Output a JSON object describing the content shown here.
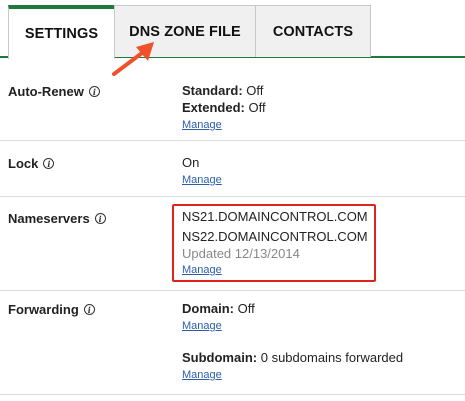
{
  "tabs": {
    "settings": "SETTINGS",
    "dns_zone_file": "DNS ZONE FILE",
    "contacts": "CONTACTS",
    "active": "SETTINGS"
  },
  "auto_renew": {
    "label": "Auto-Renew",
    "standard_label": "Standard:",
    "standard_value": "Off",
    "extended_label": "Extended:",
    "extended_value": "Off",
    "manage": "Manage"
  },
  "lock": {
    "label": "Lock",
    "value": "On",
    "manage": "Manage"
  },
  "nameservers": {
    "label": "Nameservers",
    "ns1": "NS21.DOMAINCONTROL.COM",
    "ns2": "NS22.DOMAINCONTROL.COM",
    "updated": "Updated 12/13/2014",
    "manage": "Manage"
  },
  "forwarding": {
    "label": "Forwarding",
    "domain_label": "Domain:",
    "domain_value": "Off",
    "manage_domain": "Manage",
    "subdomain_label": "Subdomain:",
    "subdomain_value": "0 subdomains forwarded",
    "manage_subdomain": "Manage"
  },
  "colors": {
    "accent_green": "#1f7a3a",
    "link_blue": "#2c5fa8",
    "highlight_red": "#e2231a",
    "arrow_orange": "#f0502a"
  }
}
